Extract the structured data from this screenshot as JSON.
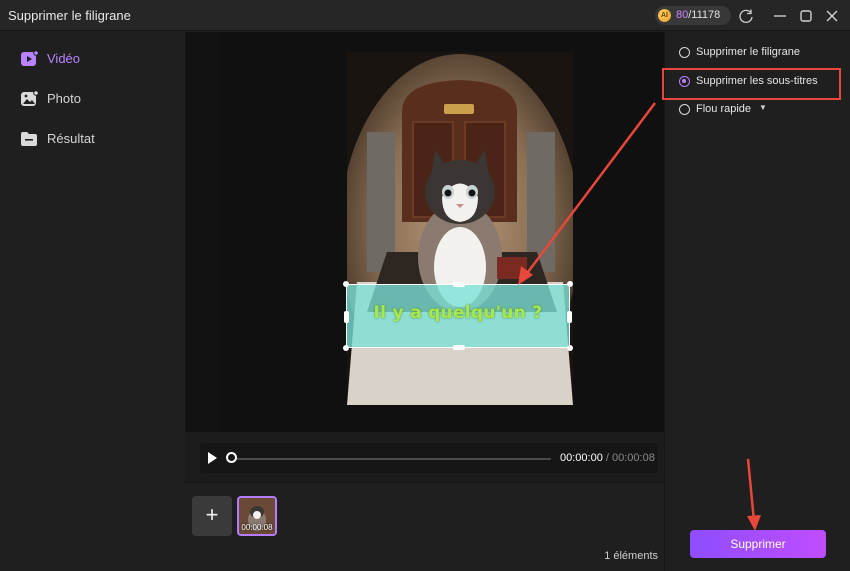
{
  "window": {
    "title": "Supprimer le filigrane",
    "credits": {
      "used": "80",
      "total": "/11178",
      "coin_label": "AI"
    },
    "controls": [
      "refresh-icon",
      "minimize-icon",
      "maximize-icon",
      "close-icon"
    ]
  },
  "sidebar": {
    "items": [
      {
        "label": "Vidéo",
        "icon": "video-icon",
        "active": true
      },
      {
        "label": "Photo",
        "icon": "photo-icon",
        "active": false
      },
      {
        "label": "Résultat",
        "icon": "folder-icon",
        "active": false
      }
    ]
  },
  "preview": {
    "subtitle_text": "Il y a quelqu'un ?"
  },
  "player": {
    "current_time": "00:00:00",
    "separator": " / ",
    "duration": "00:00:08",
    "progress": 0
  },
  "strip": {
    "add_label": "+",
    "thumbnail_time": "00:00:08",
    "count_label": "1 éléments"
  },
  "options": {
    "items": [
      {
        "label": "Supprimer le filigrane",
        "selected": false
      },
      {
        "label": "Supprimer les sous-titres",
        "selected": true
      },
      {
        "label": "Flou rapide",
        "selected": false,
        "has_dropdown": true
      }
    ],
    "apply_label": "Supprimer"
  },
  "colors": {
    "accent": "#b983ff",
    "button_gradient_start": "#8d4dff",
    "button_gradient_end": "#c04dff",
    "annotation_red": "#e8473c",
    "selection_fill": "#78e2d7"
  }
}
